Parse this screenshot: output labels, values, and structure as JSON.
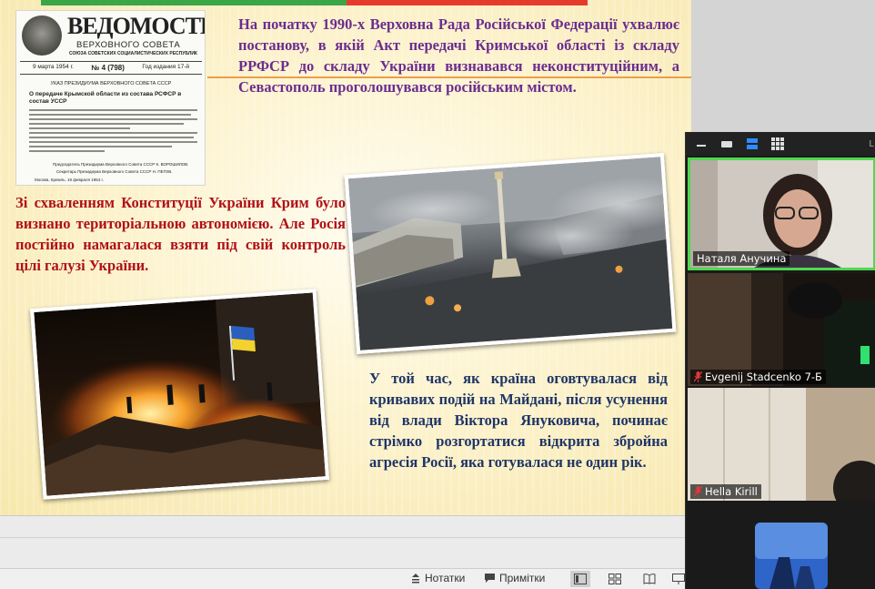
{
  "slide": {
    "top_text": "На початку 1990-х Верховна Рада Російської Федерації ухвалює постанову, в якій Акт передачі Кримської області із складу РРФСР до складу України визнавався неконституційним, а Севастополь проголошувався російським містом.",
    "left_text": "Зі схваленням Конституції України Крим було визнано територіальною автономією. Але Росія постійно намагалася взяти під свій контроль цілі галузі України.",
    "right_text": "У той час, як країна оговтувалася від кривавих подій на Майдані, після усунення від влади Віктора Януковича, починає стрімко розгортатися відкрита збройна агресія Росії, яка готувалася не один рік.",
    "newspaper": {
      "title": "ВЕДОМОСТИ",
      "subtitle": "ВЕРХОВНОГО СОВЕТА",
      "subtitle2": "СОЮЗА СОВЕТСКИХ СОЦИАЛИСТИЧЕСКИХ РЕСПУБЛИК",
      "date": "9 марта 1954 г.",
      "number": "№ 4 (798)",
      "year": "Год издания 17-й",
      "decree_head": "УКАЗ ПРЕЗИДИУМА ВЕРХОВНОГО СОВЕТА СССР",
      "lead": "О передаче Крымской области из состава РСФСР в состав УССР",
      "sign1": "Председатель Президиума Верховного Совета СССР К. ВОРОШИЛОВ.",
      "sign2": "Секретарь Президиума Верховного Совета СССР Н. ПЕГОВ.",
      "sign3": "Москва, Кремль. 19 февраля 1954 г."
    }
  },
  "zoom": {
    "participants": [
      {
        "name": "Наталя Анучина",
        "muted": false,
        "active": true
      },
      {
        "name": "Evgenij Stadcenko 7-Б",
        "muted": true,
        "active": false
      },
      {
        "name": "Hella Kirill",
        "muted": true,
        "active": false
      },
      {
        "name": "",
        "muted": false,
        "active": false
      }
    ],
    "corner_text": "L"
  },
  "statusbar": {
    "notes_label": "Нотатки",
    "comments_label": "Примітки"
  },
  "colors": {
    "top_text": "#6b2d8f",
    "left_text": "#b01016",
    "right_text": "#1f3566",
    "active_speaker": "#4fd84f",
    "muted_icon": "#e0383b"
  }
}
